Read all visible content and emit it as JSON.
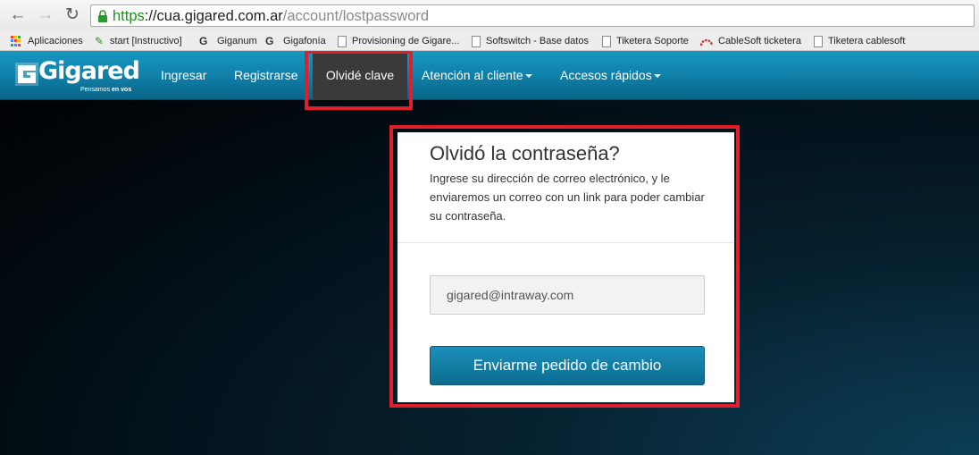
{
  "browser": {
    "url_scheme": "https",
    "url_separator": "://",
    "url_host": "cua.gigared.com.ar",
    "url_path": "/account/lostpassword"
  },
  "bookmarks": [
    {
      "label": "Aplicaciones",
      "icon": "apps-grid-icon"
    },
    {
      "label": "start [Instructivo]",
      "icon": "pencil-icon"
    },
    {
      "label": "Giganum",
      "icon": "google-g-icon"
    },
    {
      "label": "Gigafonía",
      "icon": "google-g-icon"
    },
    {
      "label": "Provisioning de Gigare...",
      "icon": "page-icon"
    },
    {
      "label": "Softswitch - Base datos",
      "icon": "page-icon"
    },
    {
      "label": "Tiketera Soporte",
      "icon": "page-icon"
    },
    {
      "label": "CableSoft ticketera",
      "icon": "cablesoft-icon"
    },
    {
      "label": "Tiketera cablesoft",
      "icon": "page-icon"
    }
  ],
  "site": {
    "brand": "Gigared",
    "tagline_normal": "Pensamos ",
    "tagline_bold": "en vos",
    "nav": [
      {
        "label": "Ingresar"
      },
      {
        "label": "Registrarse"
      },
      {
        "label": "Olvidé clave",
        "active": true
      },
      {
        "label": "Atención al cliente",
        "dropdown": true
      },
      {
        "label": "Accesos rápidos",
        "dropdown": true
      }
    ]
  },
  "form": {
    "title": "Olvidó la contraseña?",
    "description": "Ingrese su dirección de correo electrónico, y le enviaremos un correo con un link para poder cambiar su contraseña.",
    "email_value": "gigared@intraway.com",
    "submit_label": "Enviarme pedido de cambio"
  },
  "colors": {
    "navbar": "#1189b3",
    "active_nav": "#3a3a3a",
    "highlight": "#e01f2a",
    "button": "#0f7aa2",
    "url_scheme": "#1d8e1d"
  }
}
